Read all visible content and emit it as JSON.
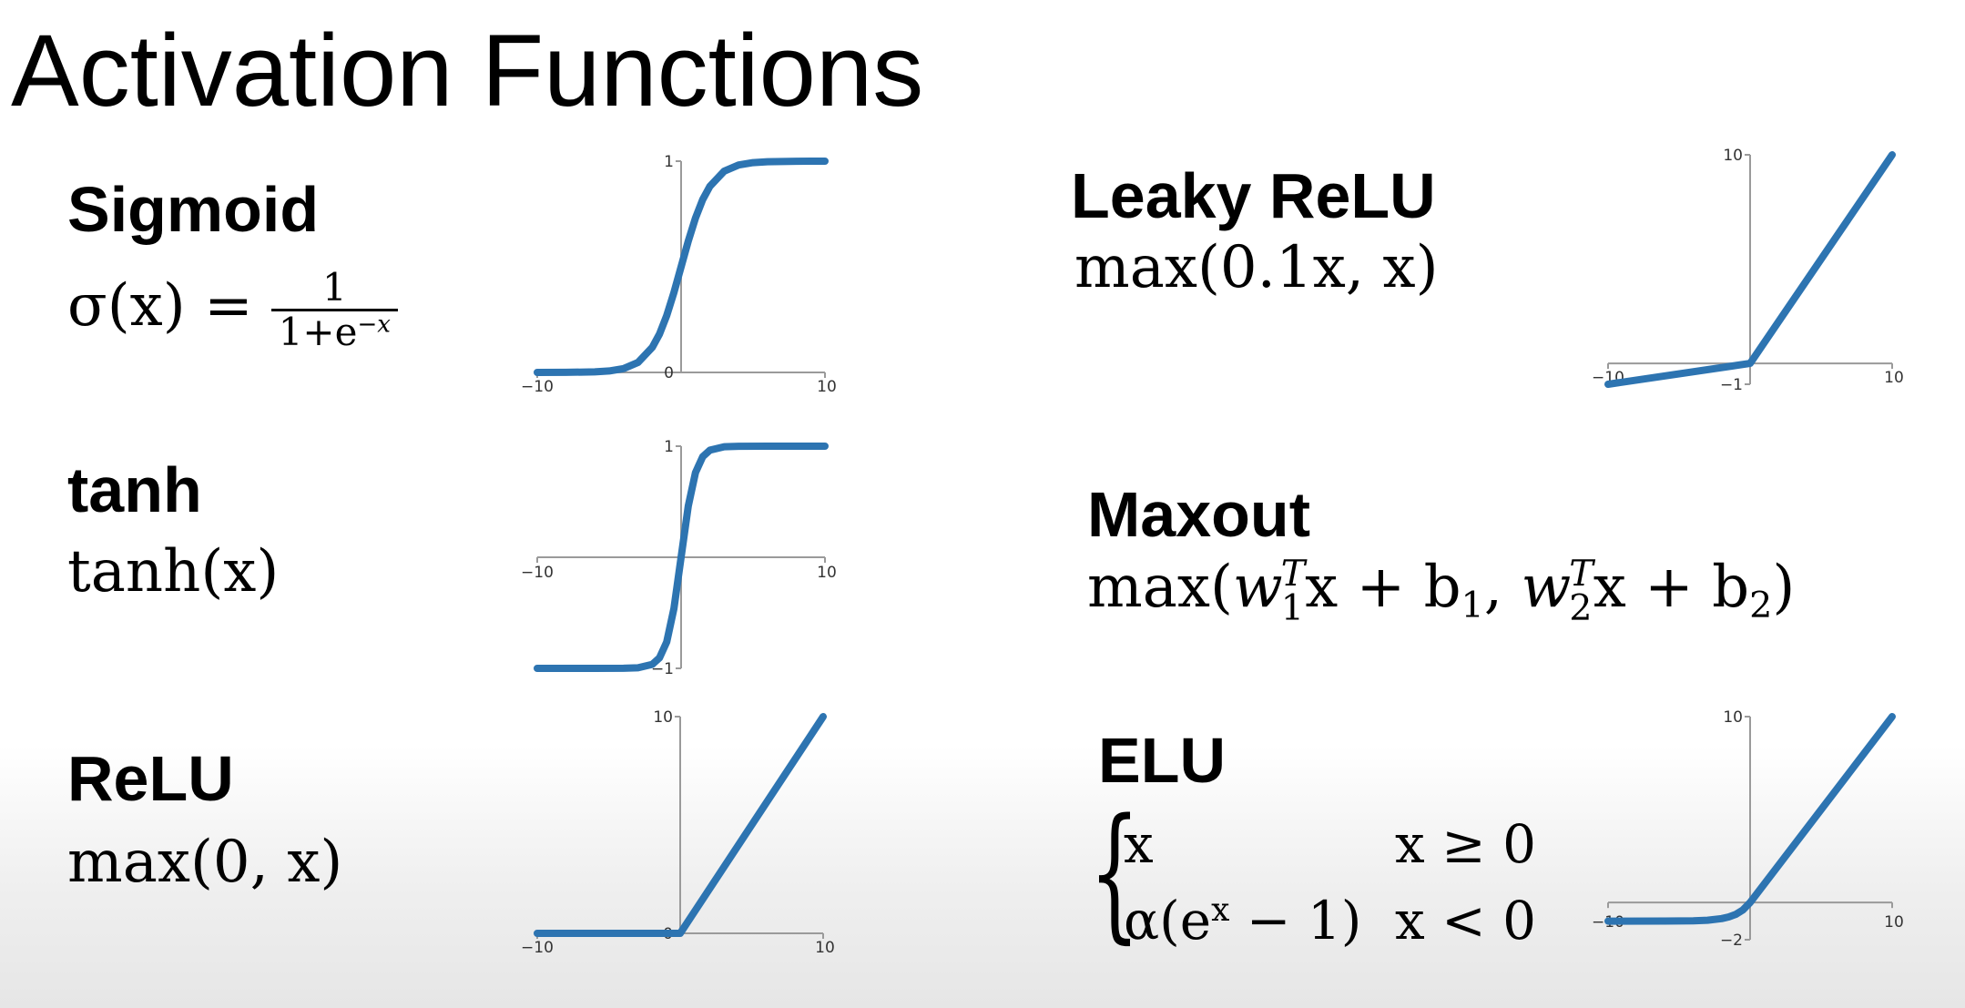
{
  "title": "Activation Functions",
  "colors": {
    "curve": "#2d74b1",
    "axis": "#9a9a9a"
  },
  "functions": {
    "sigmoid": {
      "name": "Sigmoid",
      "lhs": "σ(x) =",
      "numerator": "1",
      "denominator_base": "1+e",
      "denominator_exp": "−x"
    },
    "tanh": {
      "name": "tanh",
      "formula": "tanh(x)"
    },
    "relu": {
      "name": "ReLU",
      "formula": "max(0, x)"
    },
    "leaky_relu": {
      "name": "Leaky ReLU",
      "formula": "max(0.1x, x)"
    },
    "maxout": {
      "name": "Maxout",
      "p1": "max(",
      "w1": "w",
      "t1": "T",
      "s1": "1",
      "p2": "x + b",
      "b1": "1",
      "p3": ", ",
      "w2": "w",
      "t2": "T",
      "s2": "2",
      "p4": "x + b",
      "b2": "2",
      "p5": ")"
    },
    "elu": {
      "name": "ELU",
      "case1_value": "x",
      "case1_condition": "x ≥ 0",
      "case2_value_a": "α(e",
      "case2_value_exp": "x",
      "case2_value_b": " − 1)",
      "case2_condition": "x < 0"
    }
  },
  "chart_data": [
    {
      "id": "sigmoid",
      "type": "line",
      "xlim": [
        -10,
        10
      ],
      "ylim": [
        0,
        1
      ],
      "x_tick_labels": [
        "−10",
        "10"
      ],
      "y_tick_labels": [
        "1",
        "0"
      ],
      "x": [
        -10,
        -8,
        -6,
        -5,
        -4,
        -3,
        -2,
        -1.5,
        -1,
        -0.5,
        0,
        0.5,
        1,
        1.5,
        2,
        3,
        4,
        5,
        6,
        8,
        10
      ],
      "y": [
        5e-05,
        0.0003,
        0.0025,
        0.0067,
        0.018,
        0.047,
        0.119,
        0.182,
        0.269,
        0.378,
        0.5,
        0.622,
        0.731,
        0.818,
        0.881,
        0.953,
        0.982,
        0.993,
        0.9975,
        0.9997,
        0.99995
      ]
    },
    {
      "id": "tanh",
      "type": "line",
      "xlim": [
        -10,
        10
      ],
      "ylim": [
        -1,
        1
      ],
      "x_tick_labels": [
        "−10",
        "10"
      ],
      "y_tick_labels": [
        "1",
        "−1"
      ],
      "x": [
        -10,
        -6,
        -4,
        -3,
        -2,
        -1.5,
        -1,
        -0.5,
        0,
        0.5,
        1,
        1.5,
        2,
        3,
        4,
        6,
        10
      ],
      "y": [
        -1,
        -1,
        -0.999,
        -0.995,
        -0.964,
        -0.905,
        -0.762,
        -0.462,
        0,
        0.462,
        0.762,
        0.905,
        0.964,
        0.995,
        0.999,
        1,
        1
      ]
    },
    {
      "id": "relu",
      "type": "line",
      "xlim": [
        -10,
        10
      ],
      "ylim": [
        0,
        10
      ],
      "x_tick_labels": [
        "−10",
        "10"
      ],
      "y_tick_labels": [
        "10",
        "0"
      ],
      "x": [
        -10,
        0,
        10
      ],
      "y": [
        0,
        0,
        10
      ]
    },
    {
      "id": "leaky_relu",
      "type": "line",
      "xlim": [
        -10,
        10
      ],
      "ylim": [
        -1,
        10
      ],
      "x_tick_labels": [
        "−10",
        "10"
      ],
      "y_tick_labels": [
        "10",
        "−1"
      ],
      "x": [
        -10,
        0,
        10
      ],
      "y": [
        -1,
        0,
        10
      ]
    },
    {
      "id": "elu",
      "type": "line",
      "xlim": [
        -10,
        10
      ],
      "ylim": [
        -2,
        10
      ],
      "x_tick_labels": [
        "−10",
        "10"
      ],
      "y_tick_labels": [
        "10",
        "−2"
      ],
      "x": [
        -10,
        -6,
        -4,
        -3,
        -2,
        -1.5,
        -1,
        -0.5,
        0,
        10
      ],
      "y": [
        -1,
        -0.998,
        -0.982,
        -0.95,
        -0.865,
        -0.777,
        -0.632,
        -0.393,
        0,
        10
      ]
    }
  ]
}
